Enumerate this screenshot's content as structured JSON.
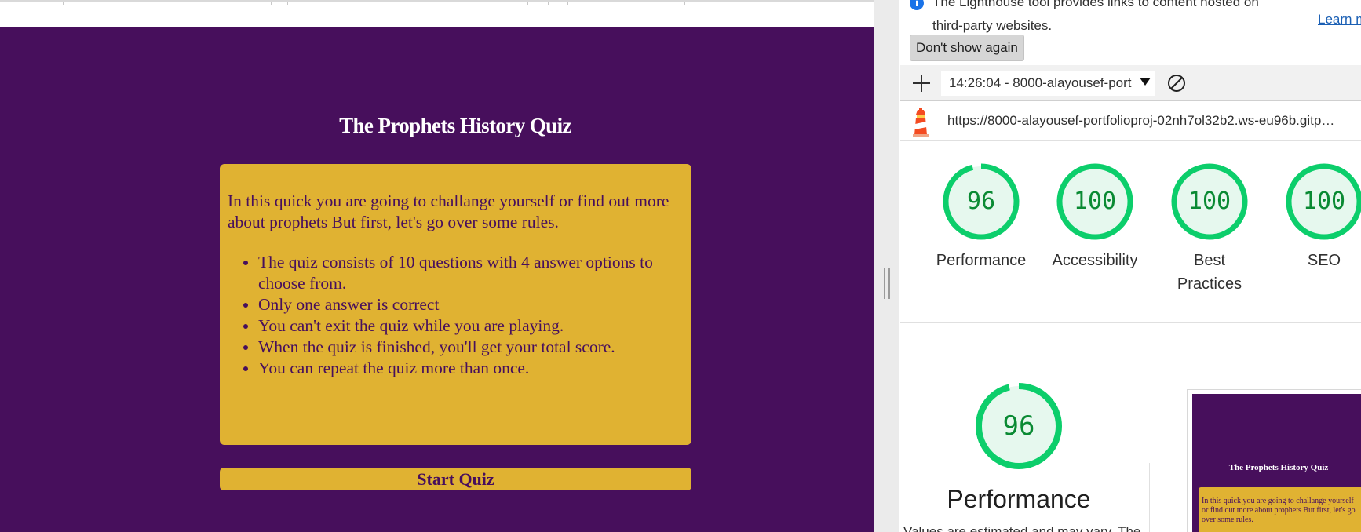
{
  "quiz": {
    "title": "The Prophets History Quiz",
    "intro": "In this quick you are going to challange yourself or find out more about prophets But first, let's go over some rules.",
    "rules": [
      "The quiz consists of 10 questions with 4 answer options to choose from.",
      "Only one answer is correct",
      "You can't exit the quiz while you are playing.",
      "When the quiz is finished, you'll get your total score.",
      "You can repeat the quiz more than once."
    ],
    "start_label": "Start Quiz",
    "colors": {
      "background": "#470f5c",
      "accent": "#e0b232",
      "title": "#ffffff"
    }
  },
  "devtools": {
    "infobar": {
      "line1": "The Lighthouse tool provides links to content hosted on",
      "line2": "third-party websites.",
      "learn_more": "Learn m",
      "dont_show": "Don't show again"
    },
    "toolbar": {
      "report_label": "14:26:04 - 8000-alayousef-port",
      "add_icon": "plus-icon",
      "clear_icon": "block-icon"
    },
    "url": "https://8000-alayousef-portfolioproj-02nh7ol32b2.ws-eu96b.gitp…",
    "scores": [
      {
        "label": "Performance",
        "value": "96",
        "fraction": 0.96
      },
      {
        "label": "Accessibility",
        "value": "100",
        "fraction": 1.0
      },
      {
        "label": "Best Practices",
        "value": "100",
        "fraction": 1.0
      },
      {
        "label": "SEO",
        "value": "100",
        "fraction": 1.0
      }
    ],
    "performance": {
      "value": "96",
      "fraction": 0.96,
      "label": "Performance",
      "cut_text": "Values are estimated and may vary. The"
    },
    "thumbnail": {
      "title": "The Prophets History Quiz",
      "intro": "In this quick you are going to challange yourself or find out more about prophets But first, let's go over some rules."
    },
    "colors": {
      "pass": "#0cce6b",
      "pass_fill": "#e6f8ee",
      "pass_text": "#0a8a33"
    }
  }
}
